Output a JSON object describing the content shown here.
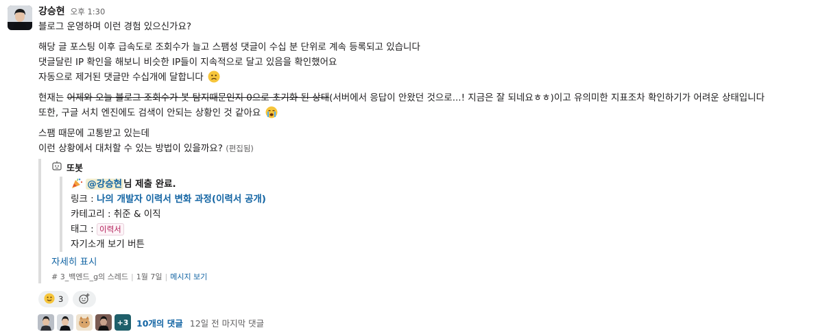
{
  "message": {
    "sender": "강승현",
    "time": "오후 1:30",
    "line1": "블로그 운영하며 이런 경험 있으신가요?",
    "para2": [
      "해당 글 포스팅 이후 급속도로 조회수가 늘고 스팸성 댓글이 수십 분 단위로 계속 등록되고 있습니다",
      "댓글달린 IP 확인을 해보니 비슷한 IP들이 지속적으로 달고 있음을 확인했어요",
      "자동으로 제거된 댓글만 수십개에 달합니다"
    ],
    "para3_prefix": "현재는 ",
    "para3_strike": "어제와 오늘 블로그 조회수가 봇 탐지때문인지 0으로 초기화 된 상태",
    "para3_rest": "(서버에서 응답이 안왔던 것으로...! 지금은 잘 되네요ㅎㅎ)이고 유의미한 지표조차 확인하기가 어려운 상태입니다",
    "para3_line2": "또한, 구글 서치 엔진에도 검색이 안되는 상황인 것 같아요",
    "para4": [
      "스팸 때문에 고통받고 있는데",
      "이런 상황에서 대처할 수 있는 방법이 있을까요?"
    ],
    "edited": "(편집됨)"
  },
  "bot": {
    "name": "또봇",
    "icon": "robot-icon",
    "mention": "@강승현",
    "submit_text": "님 제출 완료.",
    "link_label": "링크 : ",
    "link_text": "나의 개발자 이력서 변화 과정(이력서 공개)",
    "category": "카테고리 : 취준 & 이직",
    "tag_label": "태그 : ",
    "tag": "이력서",
    "intro_button": "자기소개 보기 버튼",
    "show_more": "자세히 표시",
    "footer_channel": "# 3_백엔드_g의 스레드",
    "footer_date": "1월 7일",
    "footer_view": "메시지 보기"
  },
  "reactions": [
    {
      "icon": "slightly-smiling-face-icon",
      "count": "3"
    }
  ],
  "thread": {
    "more_count": "+3",
    "replies": "10개의 댓글",
    "last_reply": "12일 전 마지막 댓글"
  },
  "colors": {
    "link": "#1264a3",
    "mention_bg": "#f2eecf",
    "tag": "#b21e58",
    "plus_bg": "#1f5f6a"
  }
}
